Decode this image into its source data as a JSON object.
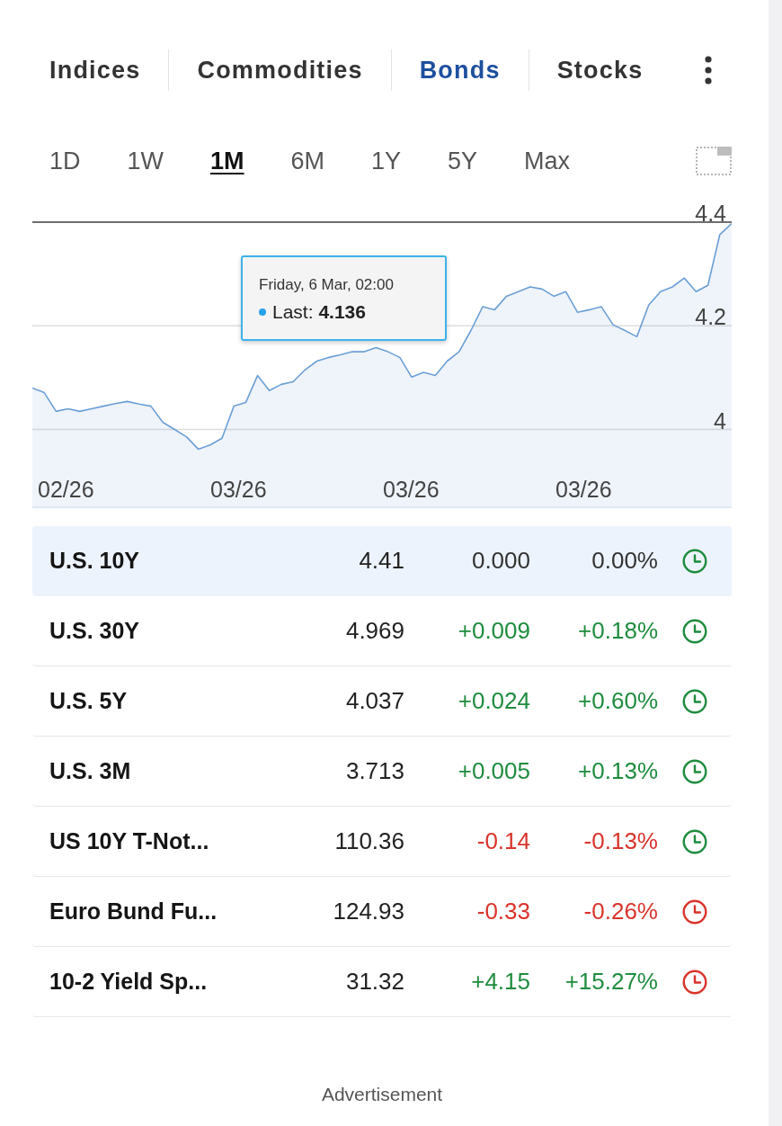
{
  "category_tabs": [
    {
      "label": "Indices",
      "selected": false
    },
    {
      "label": "Commodities",
      "selected": false
    },
    {
      "label": "Bonds",
      "selected": true
    },
    {
      "label": "Stocks",
      "selected": false
    }
  ],
  "period_tabs": [
    {
      "label": "1D",
      "selected": false
    },
    {
      "label": "1W",
      "selected": false
    },
    {
      "label": "1M",
      "selected": true
    },
    {
      "label": "6M",
      "selected": false
    },
    {
      "label": "1Y",
      "selected": false
    },
    {
      "label": "5Y",
      "selected": false
    },
    {
      "label": "Max",
      "selected": false
    }
  ],
  "chart": {
    "chart_data": {
      "type": "area",
      "series": [
        {
          "color": "#6b9fd6",
          "values": [
            4.08,
            4.071,
            4.035,
            4.04,
            4.035,
            4.04,
            4.045,
            4.05,
            4.054,
            4.049,
            4.045,
            4.014,
            4.0,
            3.986,
            3.962,
            3.97,
            3.983,
            4.045,
            4.052,
            4.104,
            4.075,
            4.087,
            4.092,
            4.115,
            4.132,
            4.139,
            4.144,
            4.15,
            4.15,
            4.158,
            4.15,
            4.139,
            4.101,
            4.11,
            4.104,
            4.132,
            4.15,
            4.191,
            4.237,
            4.231,
            4.257,
            4.266,
            4.275,
            4.271,
            4.257,
            4.266,
            4.226,
            4.231,
            4.237,
            4.202,
            4.191,
            4.179,
            4.24,
            4.266,
            4.275,
            4.292,
            4.266,
            4.278,
            4.376,
            4.397
          ]
        }
      ],
      "ylim": [
        3.85,
        4.4
      ],
      "yticks": [
        4,
        4.2,
        4.4
      ]
    },
    "x_axis_labels": [
      "02/26",
      "03/26",
      "03/26",
      "03/26"
    ],
    "tooltip": {
      "date": "Friday, 6 Mar, 02:00",
      "text": "Last: **4.136**"
    }
  },
  "table": {
    "rows": [
      {
        "name": "U.S. 10Y",
        "last": "4.41",
        "change": "0.000",
        "change_pct": "0.00%",
        "kind": "flat",
        "color": "#1e8c3e",
        "selected": true
      },
      {
        "name": "U.S. 30Y",
        "last": "4.969",
        "change": "+0.009",
        "change_pct": "+0.18%",
        "kind": "up",
        "color": "#1e8c3e",
        "selected": false
      },
      {
        "name": "U.S. 5Y",
        "last": "4.037",
        "change": "+0.024",
        "change_pct": "+0.60%",
        "kind": "up",
        "color": "#1e8c3e",
        "selected": false
      },
      {
        "name": "U.S. 3M",
        "last": "3.713",
        "change": "+0.005",
        "change_pct": "+0.13%",
        "kind": "up",
        "color": "#1e8c3e",
        "selected": false
      },
      {
        "name": "US 10Y T-Not...",
        "last": "110.36",
        "change": "-0.14",
        "change_pct": "-0.13%",
        "kind": "down",
        "color": "#1e8c3e",
        "selected": false
      },
      {
        "name": "Euro Bund Fu...",
        "last": "124.93",
        "change": "-0.33",
        "change_pct": "-0.26%",
        "kind": "down",
        "color": "#d9332b",
        "selected": false
      },
      {
        "name": "10-2 Yield Sp...",
        "last": "31.32",
        "change": "+4.15",
        "change_pct": "+15.27%",
        "kind": "up",
        "color": "#d9332b",
        "selected": false
      }
    ]
  },
  "advertisement": {
    "label": "Advertisement"
  }
}
